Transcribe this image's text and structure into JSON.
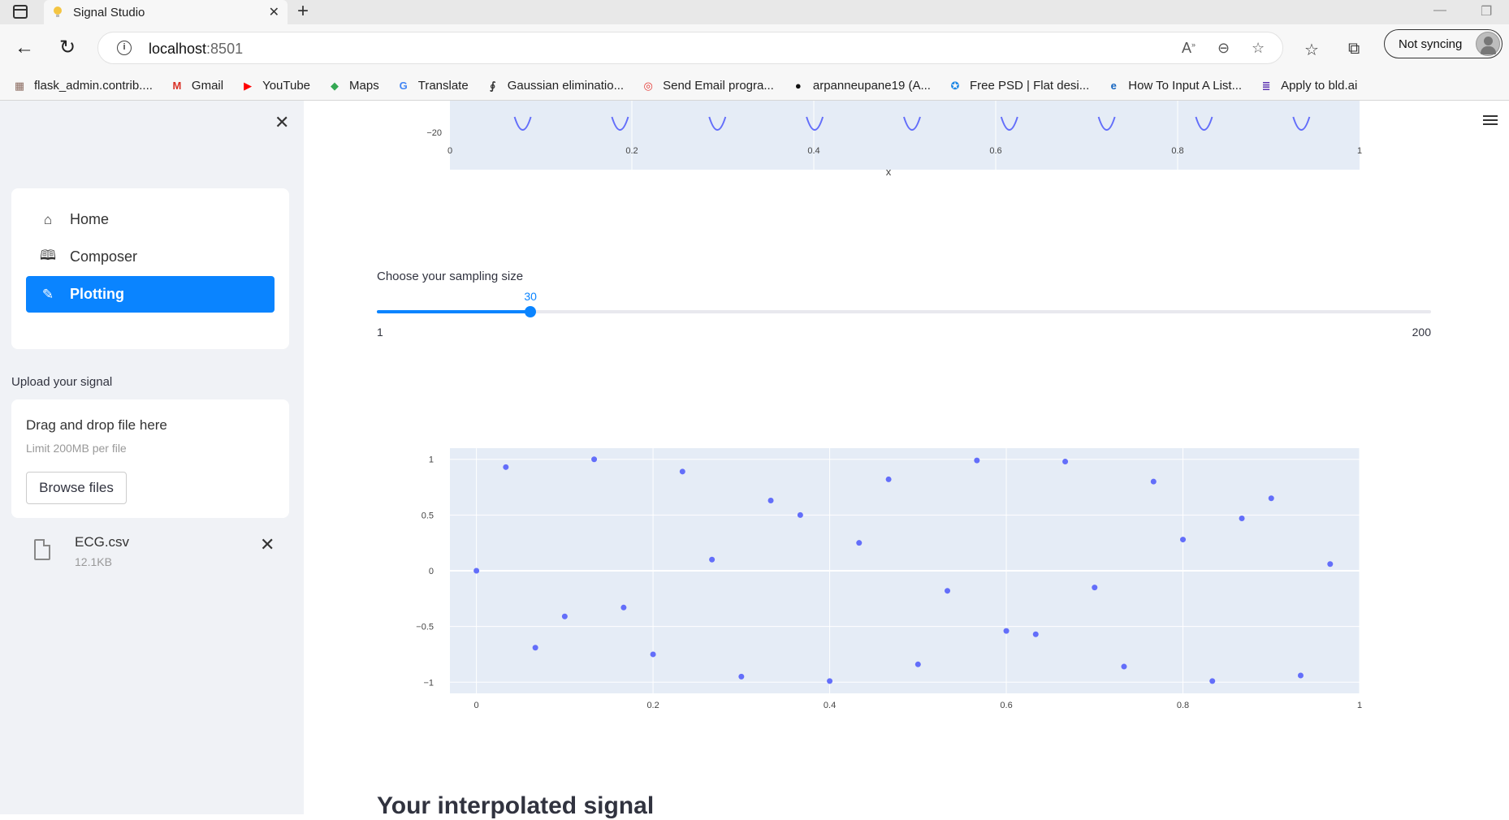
{
  "browser": {
    "tab_title": "Signal Studio",
    "url_host": "localhost",
    "url_port": ":8501",
    "sync_label": "Not syncing",
    "bookmarks": [
      {
        "label": "flask_admin.contrib....",
        "icon": "flask-icon",
        "color": "#8d6e63"
      },
      {
        "label": "Gmail",
        "icon": "gmail-icon",
        "color": "#d93025"
      },
      {
        "label": "YouTube",
        "icon": "youtube-icon",
        "color": "#ff0000"
      },
      {
        "label": "Maps",
        "icon": "maps-icon",
        "color": "#34a853"
      },
      {
        "label": "Translate",
        "icon": "translate-icon",
        "color": "#4285f4"
      },
      {
        "label": "Gaussian eliminatio...",
        "icon": "math-icon",
        "color": "#333333"
      },
      {
        "label": "Send Email progra...",
        "icon": "email-program-icon",
        "color": "#e53935"
      },
      {
        "label": "arpanneupane19 (A...",
        "icon": "github-icon",
        "color": "#111111"
      },
      {
        "label": "Free PSD | Flat desi...",
        "icon": "psd-icon",
        "color": "#1e88e5"
      },
      {
        "label": "How To Input A List...",
        "icon": "e-icon",
        "color": "#1565c0"
      },
      {
        "label": "Apply to bld.ai",
        "icon": "form-icon",
        "color": "#5e35b1"
      }
    ]
  },
  "sidebar": {
    "nav": [
      {
        "label": "Home",
        "icon": "home-icon",
        "active": false
      },
      {
        "label": "Composer",
        "icon": "book-icon",
        "active": false
      },
      {
        "label": "Plotting",
        "icon": "pen-icon",
        "active": true
      }
    ],
    "upload_label": "Upload your signal",
    "dropzone_title": "Drag and drop file here",
    "dropzone_limit": "Limit 200MB per file",
    "browse_label": "Browse files",
    "file_name": "ECG.csv",
    "file_size": "12.1KB"
  },
  "main": {
    "slider_label": "Choose your sampling size",
    "slider_value": "30",
    "slider_min": "1",
    "slider_max": "200",
    "section_heading": "Your interpolated signal"
  },
  "colors": {
    "accent": "#0a84ff",
    "plot_bg": "#e5ecf6",
    "trace": "#636efa"
  },
  "chart_data": [
    {
      "type": "line",
      "xlabel": "x",
      "ylabel": "",
      "xlim": [
        0,
        1
      ],
      "x_ticks": [
        "0",
        "0.2",
        "0.4",
        "0.6",
        "0.8",
        "1"
      ],
      "y_ticks": [
        "−20"
      ],
      "visible_trough_x": [
        0.08,
        0.187,
        0.294,
        0.401,
        0.508,
        0.615,
        0.722,
        0.829,
        0.936
      ]
    },
    {
      "type": "scatter",
      "xlim": [
        -0.03,
        1.0
      ],
      "ylim": [
        -1.1,
        1.1
      ],
      "x_ticks": [
        "0",
        "0.2",
        "0.4",
        "0.6",
        "0.8",
        "1"
      ],
      "y_ticks": [
        "1",
        "0.5",
        "0",
        "−0.5",
        "−1"
      ],
      "series": [
        {
          "x": [
            0,
            0.0333,
            0.0667,
            0.1,
            0.1333,
            0.1667,
            0.2,
            0.2333,
            0.2667,
            0.3,
            0.3333,
            0.3667,
            0.4,
            0.4333,
            0.4667,
            0.5,
            0.5333,
            0.5667,
            0.6,
            0.6333,
            0.6667,
            0.7,
            0.7333,
            0.7667,
            0.8,
            0.8333,
            0.8667,
            0.9,
            0.9333,
            0.9667
          ],
          "y": [
            0,
            0.93,
            -0.69,
            -0.41,
            1.0,
            -0.33,
            -0.75,
            0.89,
            0.1,
            -0.95,
            0.63,
            0.5,
            -0.99,
            0.25,
            0.82,
            -0.84,
            -0.18,
            0.99,
            -0.54,
            -0.57,
            0.98,
            -0.15,
            -0.86,
            0.8,
            0.28,
            -0.99,
            0.47,
            0.65,
            -0.94,
            0.06
          ]
        }
      ]
    }
  ]
}
